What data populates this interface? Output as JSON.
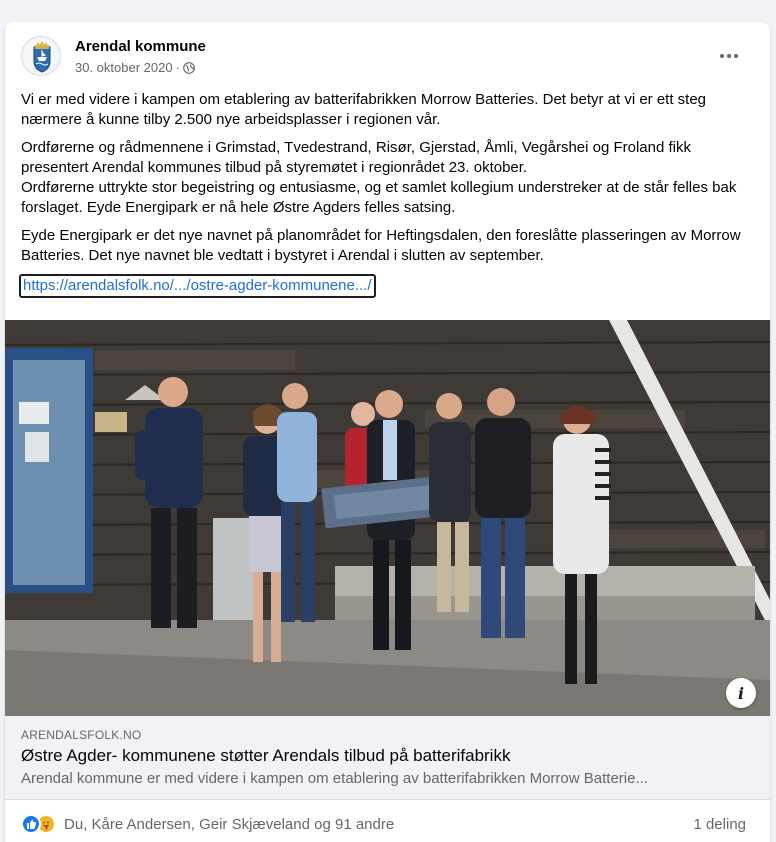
{
  "post": {
    "author": "Arendal kommune",
    "date": "30. oktober 2020",
    "date_separator": "·",
    "privacy_icon": "globe-icon",
    "more_icon": "more-options-icon",
    "paragraphs": [
      "Vi er med videre i kampen om etablering av batterifabrikken Morrow Batteries. Det betyr at vi er ett steg nærmere å kunne tilby 2.500 nye arbeidsplasser i regionen vår.",
      "Ordførerne og rådmennene i Grimstad, Tvedestrand, Risør, Gjerstad, Åmli, Vegårshei og Froland fikk presentert Arendal kommunes tilbud på styremøtet i regionrådet 23. oktober.",
      "Ordførerne uttrykte stor begeistring og entusiasme, og et samlet kollegium understreker at de står felles bak forslaget. Eyde Energipark er nå hele Østre Agders felles satsing.",
      "Eyde Energipark er det nye navnet på planområdet for Heftingsdalen, den foreslåtte plasseringen av Morrow Batteries. Det nye navnet ble vedtatt i bystyret i Arendal i slutten av september."
    ],
    "link_text": "https://arendalsfolk.no/.../ostre-agder-kommunene.../"
  },
  "preview": {
    "domain": "ARENDALSFOLK.NO",
    "title": "Østre Agder- kommunene støtter Arendals tilbud på batterifabrikk",
    "description": "Arendal kommune er med videre i kampen om etablering av batterifabrikken Morrow Batterie...",
    "info_icon": "i"
  },
  "footer": {
    "reactions_text": "Du, Kåre Andersen, Geir Skjæveland og 91 andre",
    "shares_text": "1 deling",
    "reaction_icons": [
      "like-icon",
      "care-icon"
    ]
  },
  "colors": {
    "link": "#216fdb",
    "secondary_text": "#65676b",
    "like_blue": "#1877f2",
    "care_yellow": "#f7b125"
  }
}
